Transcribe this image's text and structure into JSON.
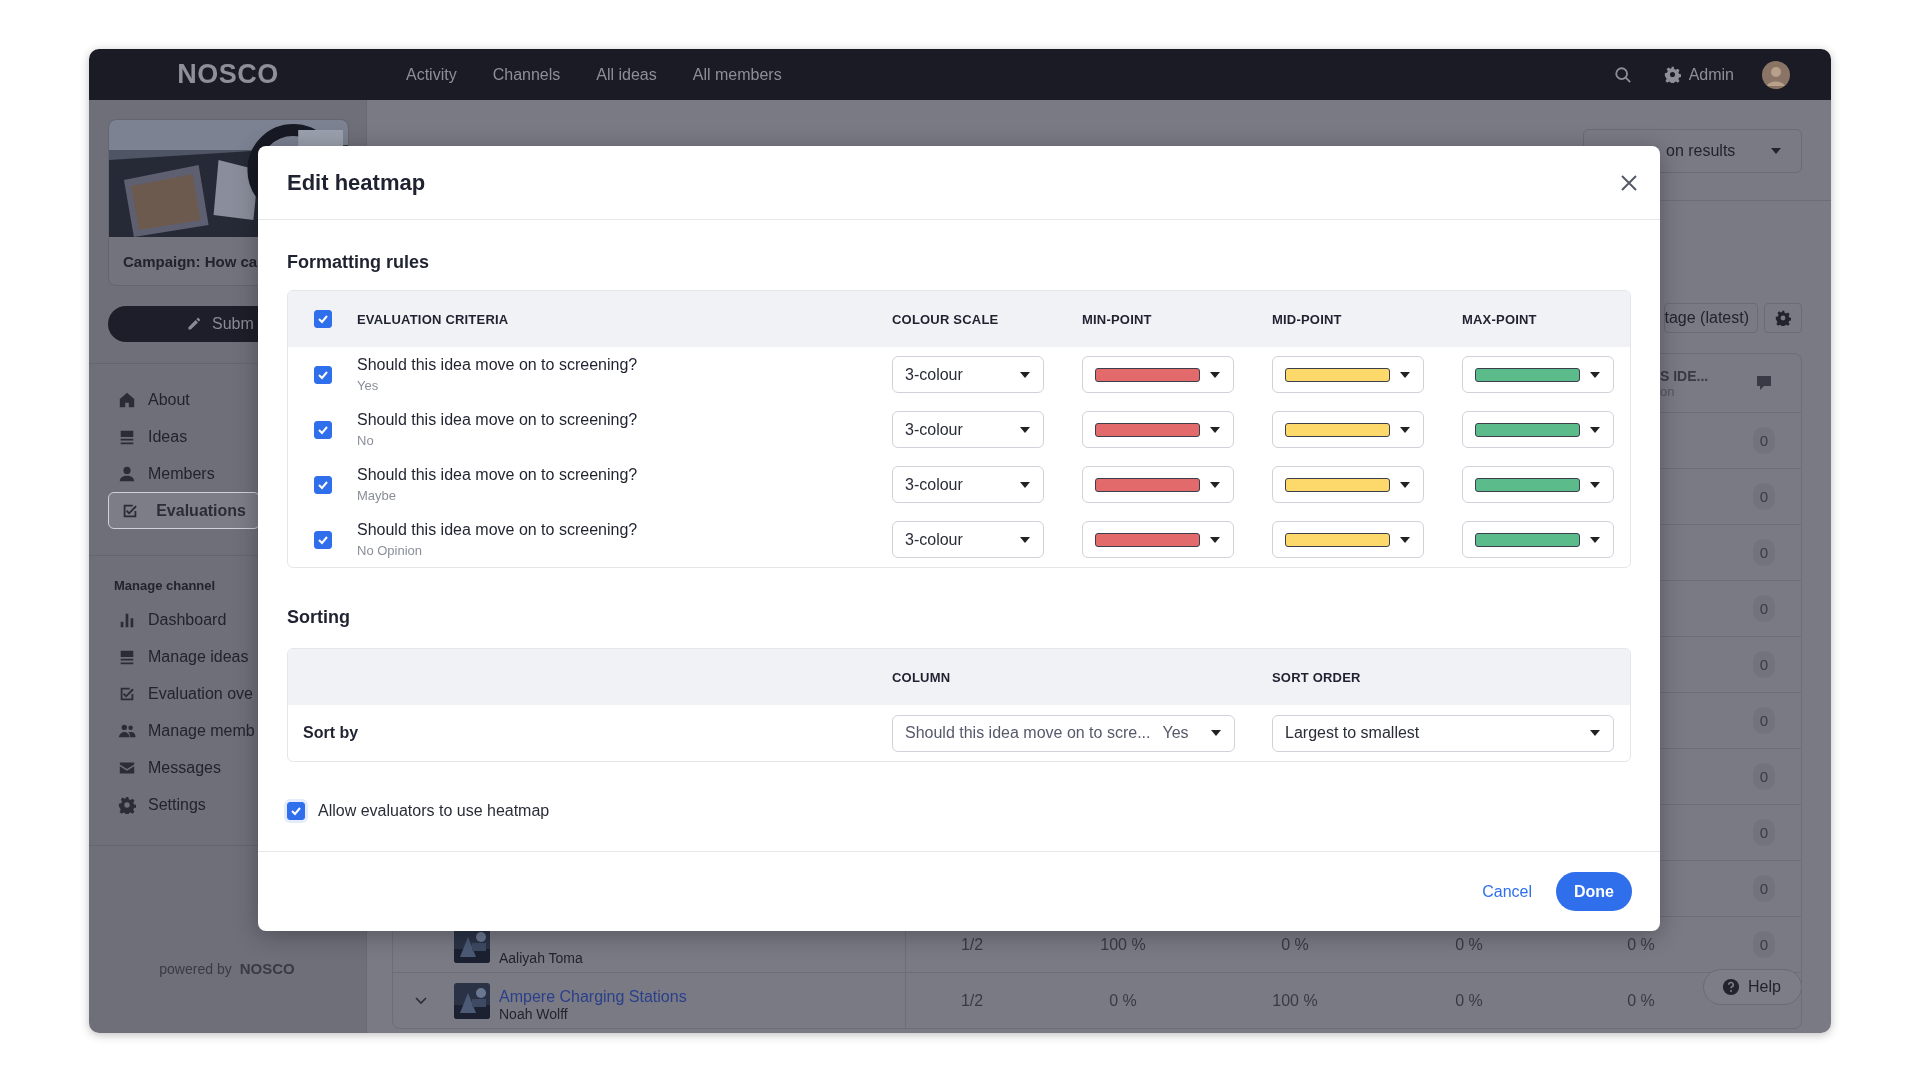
{
  "topbar": {
    "logo": "NOSCO",
    "nav": [
      {
        "label": "Activity"
      },
      {
        "label": "Channels"
      },
      {
        "label": "All ideas"
      },
      {
        "label": "All members"
      }
    ],
    "admin": "Admin"
  },
  "sidebar": {
    "campaign": "Campaign: How ca",
    "submit": "Subm",
    "items": [
      {
        "label": "About",
        "selected": false
      },
      {
        "label": "Ideas",
        "selected": false
      },
      {
        "label": "Members",
        "selected": false
      },
      {
        "label": "Evaluations",
        "selected": true
      }
    ],
    "section": "Manage channel",
    "manage_items": [
      {
        "label": "Dashboard"
      },
      {
        "label": "Manage ideas"
      },
      {
        "label": "Evaluation ove"
      },
      {
        "label": "Manage memb"
      },
      {
        "label": "Messages"
      },
      {
        "label": "Settings"
      }
    ],
    "powered_by": "powered by",
    "powered_logo": "NOSCO"
  },
  "background": {
    "results_dropdown": "on results",
    "version_button": "tage (latest)",
    "table": {
      "column_header": "S IDE...",
      "column_subheader": "on",
      "rows": [
        {
          "comments": "0"
        },
        {
          "comments": "0"
        },
        {
          "comments": "0"
        },
        {
          "comments": "0"
        },
        {
          "comments": "0"
        },
        {
          "comments": "0"
        },
        {
          "comments": "0"
        },
        {
          "comments": "0"
        },
        {
          "comments": "0"
        },
        {
          "author": "Aaliyah Toma",
          "cells": [
            "1/2",
            "100 %",
            "0 %",
            "0 %",
            "0 %"
          ],
          "comments": "0"
        },
        {
          "title": "Ampere Charging Stations",
          "author": "Noah Wolff",
          "cells": [
            "1/2",
            "0 %",
            "100 %",
            "0 %",
            "0 %"
          ]
        }
      ]
    }
  },
  "modal": {
    "title": "Edit heatmap",
    "formatting": {
      "heading": "Formatting rules",
      "all_checked": true,
      "columns": [
        "EVALUATION CRITERIA",
        "COLOUR SCALE",
        "MIN-POINT",
        "MID-POINT",
        "MAX-POINT"
      ],
      "rules": [
        {
          "question": "Should this idea move on to screening?",
          "answer": "Yes",
          "checked": true,
          "scale": "3-colour",
          "points": [
            {
              "color": "#e36a6a"
            },
            {
              "color": "#fdd96b"
            },
            {
              "color": "#5cbb8a"
            }
          ]
        },
        {
          "question": "Should this idea move on to screening?",
          "answer": "No",
          "checked": true,
          "scale": "3-colour",
          "points": [
            {
              "color": "#e36a6a"
            },
            {
              "color": "#fdd96b"
            },
            {
              "color": "#5cbb8a"
            }
          ]
        },
        {
          "question": "Should this idea move on to screening?",
          "answer": "Maybe",
          "checked": true,
          "scale": "3-colour",
          "points": [
            {
              "color": "#e36a6a"
            },
            {
              "color": "#fdd96b"
            },
            {
              "color": "#5cbb8a"
            }
          ]
        },
        {
          "question": "Should this idea move on to screening?",
          "answer": "No Opinion",
          "checked": true,
          "scale": "3-colour",
          "points": [
            {
              "color": "#e36a6a"
            },
            {
              "color": "#fdd96b"
            },
            {
              "color": "#5cbb8a"
            }
          ]
        }
      ]
    },
    "sorting": {
      "heading": "Sorting",
      "columns": [
        "COLUMN",
        "SORT ORDER"
      ],
      "label": "Sort by",
      "column_value": "Should this idea move on to scre...",
      "column_answer": "Yes",
      "order": "Largest to smallest"
    },
    "allow_heatmap": {
      "label": "Allow evaluators to use heatmap",
      "checked": true
    },
    "buttons": [
      {
        "label": "Cancel",
        "kind": "link"
      },
      {
        "label": "Done",
        "kind": "primary"
      }
    ]
  },
  "help": "Help"
}
